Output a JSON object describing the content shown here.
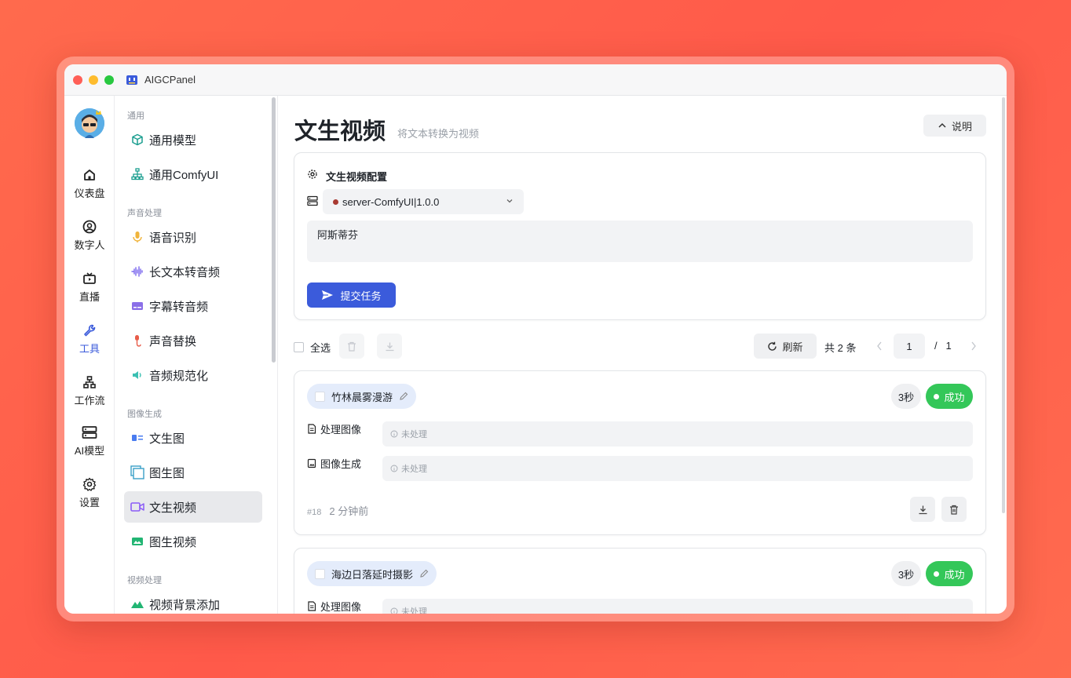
{
  "window": {
    "title": "AIGCPanel"
  },
  "rail": {
    "items": [
      {
        "label": "仪表盘",
        "icon": "home-icon",
        "active": false
      },
      {
        "label": "数字人",
        "icon": "user-circle-icon",
        "active": false
      },
      {
        "label": "直播",
        "icon": "tv-icon",
        "active": false
      },
      {
        "label": "工具",
        "icon": "wrench-icon",
        "active": true
      },
      {
        "label": "工作流",
        "icon": "workflow-icon",
        "active": false
      },
      {
        "label": "AI模型",
        "icon": "server-icon",
        "active": false
      },
      {
        "label": "设置",
        "icon": "gear-icon",
        "active": false
      }
    ]
  },
  "menu": {
    "groups": [
      {
        "title": "通用",
        "items": [
          {
            "label": "通用模型",
            "icon": "cube-icon"
          },
          {
            "label": "通用ComfyUI",
            "icon": "sitemap-icon"
          }
        ]
      },
      {
        "title": "声音处理",
        "items": [
          {
            "label": "语音识别",
            "icon": "microphone-icon"
          },
          {
            "label": "长文本转音频",
            "icon": "waveform-icon"
          },
          {
            "label": "字幕转音频",
            "icon": "subtitle-icon"
          },
          {
            "label": "声音替换",
            "icon": "mic-swap-icon"
          },
          {
            "label": "音频规范化",
            "icon": "speaker-icon"
          }
        ]
      },
      {
        "title": "图像生成",
        "items": [
          {
            "label": "文生图",
            "icon": "text-image-icon"
          },
          {
            "label": "图生图",
            "icon": "image-stack-icon"
          },
          {
            "label": "文生视频",
            "icon": "video-camera-icon",
            "active": true
          },
          {
            "label": "图生视频",
            "icon": "image-video-icon"
          }
        ]
      },
      {
        "title": "视频处理",
        "items": [
          {
            "label": "视频背景添加",
            "icon": "mountain-icon"
          }
        ]
      }
    ]
  },
  "page": {
    "title": "文生视频",
    "subtitle": "将文本转换为视频",
    "help_label": "说明"
  },
  "config": {
    "title": "文生视频配置",
    "server_value": "server-ComfyUI|1.0.0",
    "prompt_value": "阿斯蒂芬",
    "submit_label": "提交任务"
  },
  "toolbar": {
    "select_all_label": "全选",
    "refresh_label": "刷新",
    "total_label": "共 2 条",
    "page_current": "1",
    "page_separator": "/",
    "page_total": "1"
  },
  "tasks": [
    {
      "name": "竹林晨雾漫游",
      "duration": "3秒",
      "status": "成功",
      "rows": [
        {
          "label": "处理图像",
          "value": "未处理"
        },
        {
          "label": "图像生成",
          "value": "未处理"
        }
      ],
      "id": "#18",
      "time": "2 分钟前"
    },
    {
      "name": "海边日落延时摄影",
      "duration": "3秒",
      "status": "成功",
      "rows": [
        {
          "label": "处理图像",
          "value": "未处理"
        }
      ]
    }
  ],
  "colors": {
    "accent": "#3b5bdb",
    "success": "#34c759",
    "name_chip": "#e4ecfb",
    "background": "#ff5a4a"
  }
}
